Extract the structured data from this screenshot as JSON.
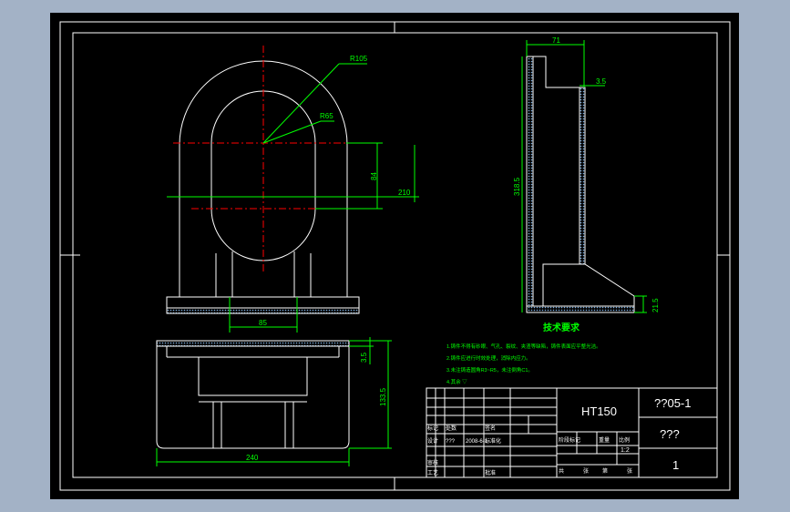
{
  "colors": {
    "background": "#a3b2c6",
    "viewport": "#000000",
    "frame": "#ffffff",
    "outline": "#ffffff",
    "dimension": "#00ff00",
    "centerline": "#ff0000",
    "hatch": "#7fb0e0",
    "title_text": "#ffffff",
    "notes_text": "#00ff00",
    "table_text": "#ffffff"
  },
  "drawing": {
    "dimensions": {
      "r105": "R105",
      "r65": "R65",
      "d84": "84",
      "d210": "210",
      "d85": "85",
      "d71": "71",
      "d3_5_top": "3.5",
      "d318_5": "318.5",
      "d21_5": "21.5",
      "d3_5_front": "3.5",
      "d133_5": "133.5",
      "d240": "240"
    },
    "tech_requirements": {
      "title": "技术要求",
      "lines": [
        "1.铸件不得有砂眼、气孔、裂纹、夹渣等缺陷，铸件表面应平整光洁。",
        "2.铸件应进行时效处理，消除内应力。",
        "3.未注铸造圆角R3~R5，未注倒角C1。",
        "4.其余 ▽"
      ]
    },
    "title_block": {
      "material": "HT150",
      "drawing_no": "??05-1",
      "part_name": "???",
      "design_label": "设计",
      "designer": "???",
      "date": "2008-6-1",
      "scale": "1:2",
      "sheet": "1",
      "mark_label": "标记",
      "count_label": "处数",
      "sign_label": "签名",
      "review_label": "审核",
      "process_label": "工艺",
      "std_label": "标准化",
      "stage_label": "阶段标记",
      "weight_label": "重量",
      "ratio_label": "比例",
      "approve_label": "批准",
      "total_label": "共",
      "page_label": "第",
      "zhang": "张"
    }
  }
}
